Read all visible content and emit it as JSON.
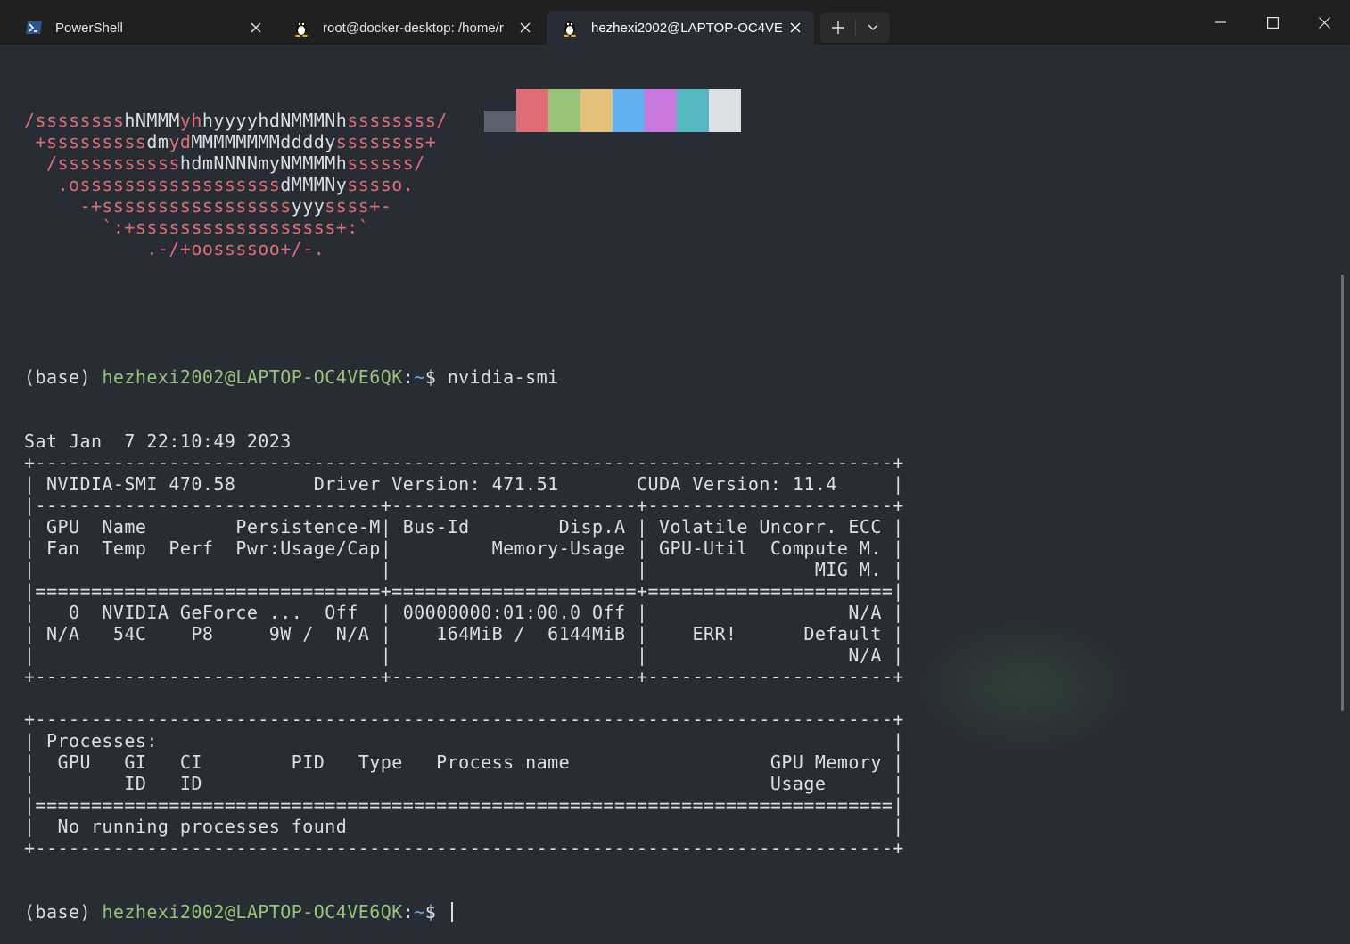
{
  "tabs": [
    {
      "label": "PowerShell",
      "icon": "powershell-icon"
    },
    {
      "label": "root@docker-desktop: /home/r",
      "icon": "linux-penguin-icon"
    },
    {
      "label": "hezhexi2002@LAPTOP-OC4VE",
      "icon": "linux-penguin-icon",
      "active": true
    }
  ],
  "colors": {
    "background": "#282c34",
    "red": "#e06c75",
    "green": "#98c379",
    "blue": "#61afef",
    "palette_top": [
      "#282c34",
      "#e06c75",
      "#98c379",
      "#e5c07b",
      "#61afef",
      "#c678dd",
      "#56b6c2",
      "#dcdfe4"
    ],
    "palette_bottom": [
      "#5c6370"
    ]
  },
  "neofetch_art": [
    {
      "segments": [
        [
          "red",
          "/ssssssss"
        ],
        [
          "white",
          "hNMMM"
        ],
        [
          "red",
          "yh"
        ],
        [
          "white",
          "hyyyyhdNMMMNh"
        ],
        [
          "red",
          "ssssssss/"
        ]
      ]
    },
    {
      "segments": [
        [
          "red",
          " +sssssssss"
        ],
        [
          "white",
          "dm"
        ],
        [
          "red",
          "yd"
        ],
        [
          "white",
          "MMMMMMMMddddy"
        ],
        [
          "red",
          "ssssssss+"
        ]
      ]
    },
    {
      "segments": [
        [
          "red",
          "  /sssssssssss"
        ],
        [
          "white",
          "hdmNNNNmyNMMMMh"
        ],
        [
          "red",
          "ssssss/"
        ]
      ]
    },
    {
      "segments": [
        [
          "red",
          "   .ossssssssssssssssss"
        ],
        [
          "white",
          "dMMMNy"
        ],
        [
          "red",
          "sssso."
        ]
      ]
    },
    {
      "segments": [
        [
          "red",
          "     -+sssssssssssssssss"
        ],
        [
          "white",
          "yyy"
        ],
        [
          "red",
          "ssss+-"
        ]
      ]
    },
    {
      "segments": [
        [
          "red",
          "       `:+ssssssssssssssssss+:`"
        ]
      ]
    },
    {
      "segments": [
        [
          "red",
          "           .-/+oossssoo+/-."
        ]
      ]
    }
  ],
  "prompt": {
    "env": "(base) ",
    "user_host": "hezhexi2002@LAPTOP-OC4VE6QK",
    "colon": ":",
    "path": "~",
    "dollar": "$ "
  },
  "command": "nvidia-smi",
  "output_lines": [
    "Sat Jan  7 22:10:49 2023",
    "+-----------------------------------------------------------------------------+",
    "| NVIDIA-SMI 470.58       Driver Version: 471.51       CUDA Version: 11.4     |",
    "|-------------------------------+----------------------+----------------------+",
    "| GPU  Name        Persistence-M| Bus-Id        Disp.A | Volatile Uncorr. ECC |",
    "| Fan  Temp  Perf  Pwr:Usage/Cap|         Memory-Usage | GPU-Util  Compute M. |",
    "|                               |                      |               MIG M. |",
    "|===============================+======================+======================|",
    "|   0  NVIDIA GeForce ...  Off  | 00000000:01:00.0 Off |                  N/A |",
    "| N/A   54C    P8     9W /  N/A |    164MiB /  6144MiB |    ERR!      Default |",
    "|                               |                      |                  N/A |",
    "+-------------------------------+----------------------+----------------------+",
    "",
    "+-----------------------------------------------------------------------------+",
    "| Processes:                                                                  |",
    "|  GPU   GI   CI        PID   Type   Process name                  GPU Memory |",
    "|        ID   ID                                                   Usage      |",
    "|=============================================================================|",
    "|  No running processes found                                                 |",
    "+-----------------------------------------------------------------------------+"
  ]
}
